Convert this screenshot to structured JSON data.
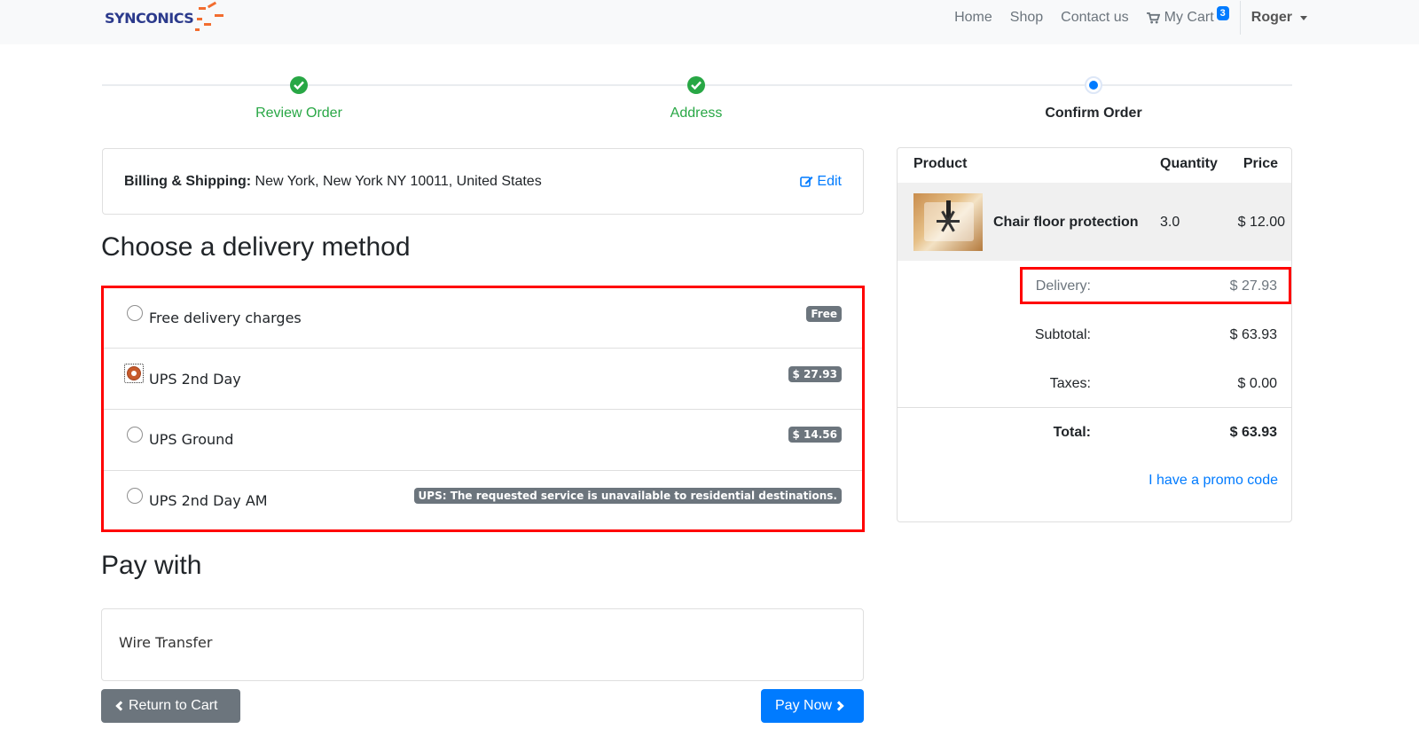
{
  "brand": {
    "name": "SYNCONICS",
    "accent": "#f26d2f"
  },
  "nav": {
    "links": [
      "Home",
      "Shop",
      "Contact us"
    ],
    "cart_label": "My Cart",
    "cart_count": "3",
    "user": "Roger"
  },
  "wizard": {
    "steps": [
      {
        "label": "Review Order",
        "state": "done"
      },
      {
        "label": "Address",
        "state": "done"
      },
      {
        "label": "Confirm Order",
        "state": "active"
      }
    ]
  },
  "billing": {
    "label": "Billing & Shipping:",
    "address": " New York, New York NY 10011, United States",
    "edit_label": "Edit"
  },
  "delivery": {
    "heading": "Choose a delivery method",
    "methods": [
      {
        "name": "Free delivery charges",
        "badge": "Free",
        "selected": false
      },
      {
        "name": "UPS 2nd Day",
        "badge": "$ 27.93",
        "selected": true
      },
      {
        "name": "UPS Ground",
        "badge": "$ 14.56",
        "selected": false
      },
      {
        "name": "UPS 2nd Day AM",
        "badge": "UPS: The requested service is unavailable to residential destinations.",
        "selected": false
      }
    ]
  },
  "payment": {
    "heading": "Pay with",
    "method": "Wire Transfer",
    "return_label": "Return to Cart",
    "pay_label": "Pay Now"
  },
  "summary": {
    "headers": {
      "product": "Product",
      "quantity": "Quantity",
      "price": "Price"
    },
    "product": {
      "name": "Chair floor protection",
      "quantity": "3.0",
      "price": "$ 12.00"
    },
    "delivery_label": "Delivery:",
    "delivery_value": "$ 27.93",
    "subtotal_label": "Subtotal:",
    "subtotal_value": "$ 63.93",
    "taxes_label": "Taxes:",
    "taxes_value": "$ 0.00",
    "total_label": "Total:",
    "total_value": "$ 63.93",
    "promo_label": "I have a promo code"
  },
  "colors": {
    "success": "#28a745",
    "primary": "#007bff",
    "secondary": "#6c757d",
    "highlight": "#ff0000"
  }
}
